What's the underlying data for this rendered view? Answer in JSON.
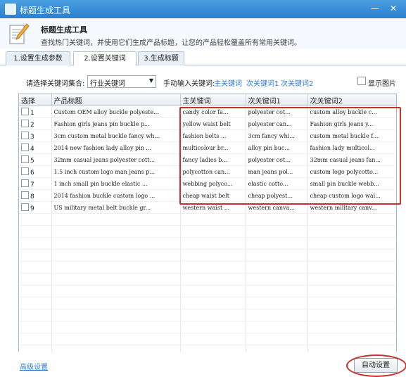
{
  "window": {
    "title": "标题生成工具",
    "min_label": "—",
    "close_label": "✕"
  },
  "header": {
    "title": "标题生成工具",
    "description": "查找热门关键词，并使用它们生成产品标题，让您的产品轻松覆盖所有常用关键词。"
  },
  "tabs": [
    {
      "label": "1.设置生成参数",
      "active": false
    },
    {
      "label": "2.设置关键词",
      "active": true
    },
    {
      "label": "3.生成标题",
      "active": false
    }
  ],
  "toolbar": {
    "set_label": "请选择关键词集合:",
    "set_value": "行业关键词",
    "manual_label": "手动输入关键词:",
    "link_main": "主关键词",
    "link_sub1": "次关键词1",
    "link_sub2": "次关键词2",
    "show_image_label": "显示图片"
  },
  "table": {
    "columns": [
      "选择",
      "产品标题",
      "主关键词",
      "次关键词1",
      "次关键词2"
    ],
    "rows": [
      {
        "num": "1",
        "title": "Custom OEM alloy buckle polyeste...",
        "main": "candy color fa...",
        "sub1": "polyester cot...",
        "sub2": "custom alloy buckle c..."
      },
      {
        "num": "2",
        "title": "Fashion girls jeans pin buckle p...",
        "main": "yellow waist belt",
        "sub1": "polyester can...",
        "sub2": "Fashion girls jeans y..."
      },
      {
        "num": "3",
        "title": "3cm custom metal buckle fancy wh...",
        "main": "fashion belts ...",
        "sub1": "3cm fancy whi...",
        "sub2": "custom metal buckle f..."
      },
      {
        "num": "4",
        "title": "2014 new fashion lady alloy pin ...",
        "main": "multicolour br...",
        "sub1": "alloy pin buc...",
        "sub2": "fashion lady multicol..."
      },
      {
        "num": "5",
        "title": "32mm casual jeans polyester cott...",
        "main": "fancy ladies b...",
        "sub1": "polyester cot...",
        "sub2": "32mm casual jeans fan..."
      },
      {
        "num": "6",
        "title": "1.5 inch custom logo man jeans p...",
        "main": "polycotton can...",
        "sub1": "man jeans pol...",
        "sub2": "custom logo polycotto..."
      },
      {
        "num": "7",
        "title": "1 inch small pin buckle elastic ...",
        "main": "webbing polyco...",
        "sub1": "elastic cotto...",
        "sub2": "small pin buckle webb..."
      },
      {
        "num": "8",
        "title": "2014 fashion buckle custom logo ...",
        "main": "cheap waist belt",
        "sub1": "cheap polyest...",
        "sub2": "cheap custom logo wai..."
      },
      {
        "num": "9",
        "title": "US military metal belt buckle gr...",
        "main": "western waist ...",
        "sub1": "western canva...",
        "sub2": "western military canv..."
      }
    ]
  },
  "footer": {
    "advanced_link": "高级设置",
    "auto_button": "自动设置"
  },
  "colors": {
    "titlebar": "#2b7fcf",
    "link": "#2f7bd6",
    "highlight": "#c8302c"
  }
}
